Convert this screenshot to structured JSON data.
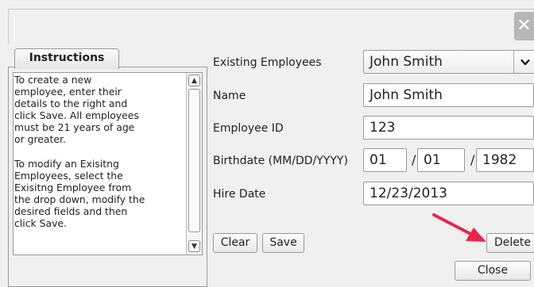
{
  "window": {
    "close_glyph": "✕"
  },
  "instructions": {
    "tab_label": "Instructions",
    "text": "To create a new\nemployee, enter their\ndetails to the right and\nclick Save. All employees\nmust be 21 years of age\nor greater.\n\nTo modify an Exisitng\nEmployees, select the\nExisitng Employee from\nthe drop down, modify the\ndesired fields and then\nclick Save."
  },
  "form": {
    "existing_label": "Existing Employees",
    "existing_value": "John Smith",
    "name_label": "Name",
    "name_value": "John Smith",
    "id_label": "Employee ID",
    "id_value": "123",
    "birth_label": "Birthdate (MM/DD/YYYY)",
    "birth_month": "01",
    "birth_day": "01",
    "birth_year": "1982",
    "date_sep": "/",
    "hire_label": "Hire Date",
    "hire_value": "12/23/2013"
  },
  "buttons": {
    "clear": "Clear",
    "save": "Save",
    "delete": "Delete",
    "close": "Close"
  },
  "annotation": {
    "arrow_color": "#e8264a"
  }
}
